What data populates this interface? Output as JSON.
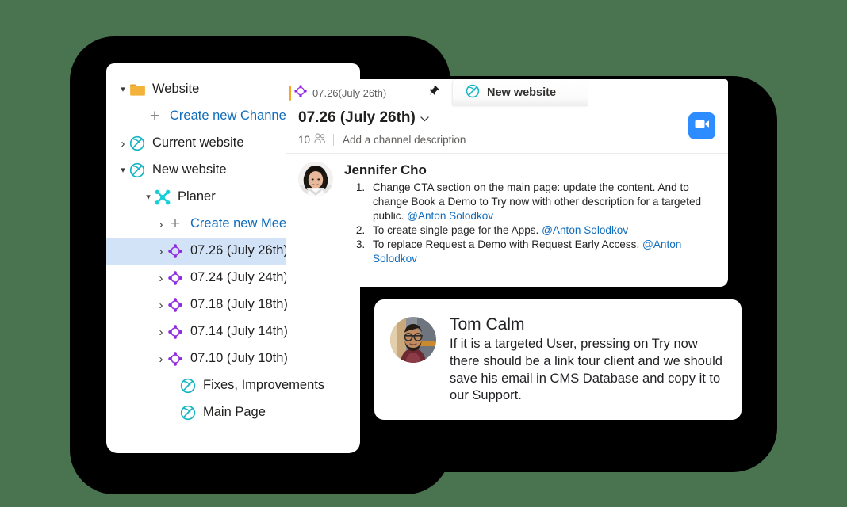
{
  "theme": {
    "page_background": "#4a7350",
    "backdrop": "#000000",
    "accent_blue": "#0f6cbd",
    "accent_teal": "#16b5c4",
    "accent_purple": "#8a2be2",
    "accent_orange": "#f7a823",
    "video_button": "#2d8cff",
    "selected_row": "#d3e3f7"
  },
  "sidebar": {
    "items": [
      {
        "label": "Website",
        "icon": "folder-icon",
        "caret": "down",
        "indent": "ind0",
        "link": false,
        "selected": false
      },
      {
        "label": "Create new Channel",
        "icon": "plus-icon",
        "caret": "none",
        "indent": "ind1",
        "link": true,
        "selected": false
      },
      {
        "label": "Current website",
        "icon": "globe-icon",
        "caret": "right",
        "indent": "ind0",
        "link": false,
        "selected": false
      },
      {
        "label": "New website",
        "icon": "globe-icon",
        "caret": "down",
        "indent": "ind0",
        "link": false,
        "selected": false
      },
      {
        "label": "Planer",
        "icon": "planer-icon",
        "caret": "down",
        "indent": "ind2",
        "link": false,
        "selected": false
      },
      {
        "label": "Create new Meeting",
        "icon": "plus-icon",
        "caret": "right",
        "indent": "ind3",
        "link": true,
        "selected": false
      },
      {
        "label": "07.26 (July 26th)",
        "icon": "meeting-icon",
        "caret": "right",
        "indent": "ind3",
        "link": false,
        "selected": true
      },
      {
        "label": "07.24 (July 24th)",
        "icon": "meeting-icon",
        "caret": "right",
        "indent": "ind3",
        "link": false,
        "selected": false
      },
      {
        "label": "07.18 (July 18th)",
        "icon": "meeting-icon",
        "caret": "right",
        "indent": "ind3",
        "link": false,
        "selected": false
      },
      {
        "label": "07.14 (July 14th)",
        "icon": "meeting-icon",
        "caret": "right",
        "indent": "ind3",
        "link": false,
        "selected": false
      },
      {
        "label": "07.10 (July 10th)",
        "icon": "meeting-icon",
        "caret": "right",
        "indent": "ind3",
        "link": false,
        "selected": false
      },
      {
        "label": "Fixes, Improvements",
        "icon": "globe-icon",
        "caret": "none",
        "indent": "ind4",
        "link": false,
        "selected": false
      },
      {
        "label": "Main Page",
        "icon": "globe-icon",
        "caret": "none",
        "indent": "ind4",
        "link": false,
        "selected": false
      }
    ]
  },
  "tabs": {
    "active": {
      "title": "07.26(July 26th)",
      "icon": "meeting-icon",
      "pin_icon": "pin-icon"
    },
    "inactive": {
      "title": "New website",
      "icon": "globe-icon"
    }
  },
  "channel": {
    "title": "07.26 (July 26th)",
    "chevron": "⌄",
    "member_count": "10",
    "members_icon": "people-icon",
    "description_placeholder": "Add a channel description",
    "video_button_icon": "video-camera-icon"
  },
  "message": {
    "sender": "Jennifer Cho",
    "avatar": "jennifer-cho-avatar",
    "tasks": [
      {
        "text": "Change CTA section on the main page: update the content. And to change Book a Demo to Try now with other description for a targeted public. ",
        "mention": "@Anton Solodkov",
        "after": ""
      },
      {
        "text": "To create single page for the Apps. ",
        "mention": "@Anton Solodkov",
        "after": ""
      },
      {
        "text": "To replace Request a Demo with Request Early Access. ",
        "mention": "@Anton Solodkov",
        "after": ""
      }
    ]
  },
  "comment_card": {
    "name": "Tom Calm",
    "avatar": "tom-calm-avatar",
    "text": "If it is a targeted User, pressing on Try now there should be a link tour client and we should save his email in CMS Database and copy it to our Support."
  }
}
